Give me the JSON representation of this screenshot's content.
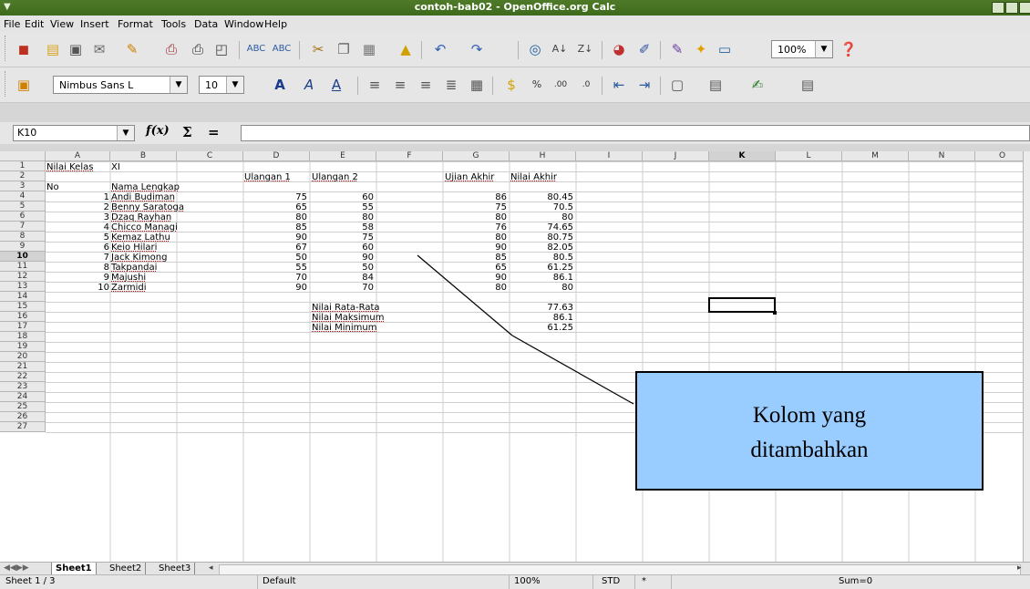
{
  "window": {
    "title": "contoh-bab02 - OpenOffice.org Calc"
  },
  "menu": [
    "File",
    "Edit",
    "View",
    "Insert",
    "Format",
    "Tools",
    "Data",
    "Window",
    "Help"
  ],
  "toolbar": {
    "zoom": "100%",
    "font_name": "Nimbus Sans L",
    "font_size": "10"
  },
  "formula_bar": {
    "cell_ref": "K10",
    "fx": "f(x)",
    "sum": "Σ",
    "equals": "="
  },
  "columns": [
    "A",
    "B",
    "C",
    "D",
    "E",
    "F",
    "G",
    "H",
    "I",
    "J",
    "K",
    "L",
    "M",
    "N",
    "O"
  ],
  "rows": [
    "1",
    "2",
    "3",
    "4",
    "5",
    "6",
    "7",
    "8",
    "9",
    "10",
    "11",
    "12",
    "13",
    "14",
    "15",
    "16",
    "17",
    "18",
    "19",
    "20",
    "21",
    "22",
    "23",
    "24",
    "25",
    "26",
    "27"
  ],
  "sheet": {
    "a1": "Nilai Kelas",
    "b1": "XI",
    "d2": "Ulangan 1",
    "e2": "Ulangan 2",
    "g2": "Ujian Akhir",
    "h2": "Nilai Akhir",
    "a3": "No",
    "b3": "Nama Lengkap",
    "students": [
      {
        "no": "1",
        "name": "Andi Budiman",
        "u1": "75",
        "u2": "60",
        "ua": "86",
        "na": "80.45"
      },
      {
        "no": "2",
        "name": "Benny Saratoga",
        "u1": "65",
        "u2": "55",
        "ua": "75",
        "na": "70.5"
      },
      {
        "no": "3",
        "name": "Dzaq Rayhan",
        "u1": "80",
        "u2": "80",
        "ua": "80",
        "na": "80"
      },
      {
        "no": "4",
        "name": "Chicco Managi",
        "u1": "85",
        "u2": "58",
        "ua": "76",
        "na": "74.65"
      },
      {
        "no": "5",
        "name": "Kemaz Lathu",
        "u1": "90",
        "u2": "75",
        "ua": "80",
        "na": "80.75"
      },
      {
        "no": "6",
        "name": "Keio Hilari",
        "u1": "67",
        "u2": "60",
        "ua": "90",
        "na": "82.05"
      },
      {
        "no": "7",
        "name": "Jack Kimong",
        "u1": "50",
        "u2": "90",
        "ua": "85",
        "na": "80.5"
      },
      {
        "no": "8",
        "name": "Takpandai",
        "u1": "55",
        "u2": "50",
        "ua": "65",
        "na": "61.25"
      },
      {
        "no": "9",
        "name": "Majushi",
        "u1": "70",
        "u2": "84",
        "ua": "90",
        "na": "86.1"
      },
      {
        "no": "10",
        "name": "Zarmidi",
        "u1": "90",
        "u2": "70",
        "ua": "80",
        "na": "80"
      }
    ],
    "summary": [
      {
        "label": "Nilai Rata-Rata",
        "value": "77.63"
      },
      {
        "label": "Nilai Maksimum",
        "value": "86.1"
      },
      {
        "label": "Nilai Minimum",
        "value": "61.25"
      }
    ]
  },
  "callout": {
    "line1": "Kolom yang",
    "line2": "ditambahkan",
    "fill": "#99ccff"
  },
  "tabs": [
    "Sheet1",
    "Sheet2",
    "Sheet3"
  ],
  "status": {
    "sheet": "Sheet 1 / 3",
    "style": "Default",
    "zoom": "100%",
    "mode": "STD",
    "modified": "*",
    "sum": "Sum=0"
  }
}
